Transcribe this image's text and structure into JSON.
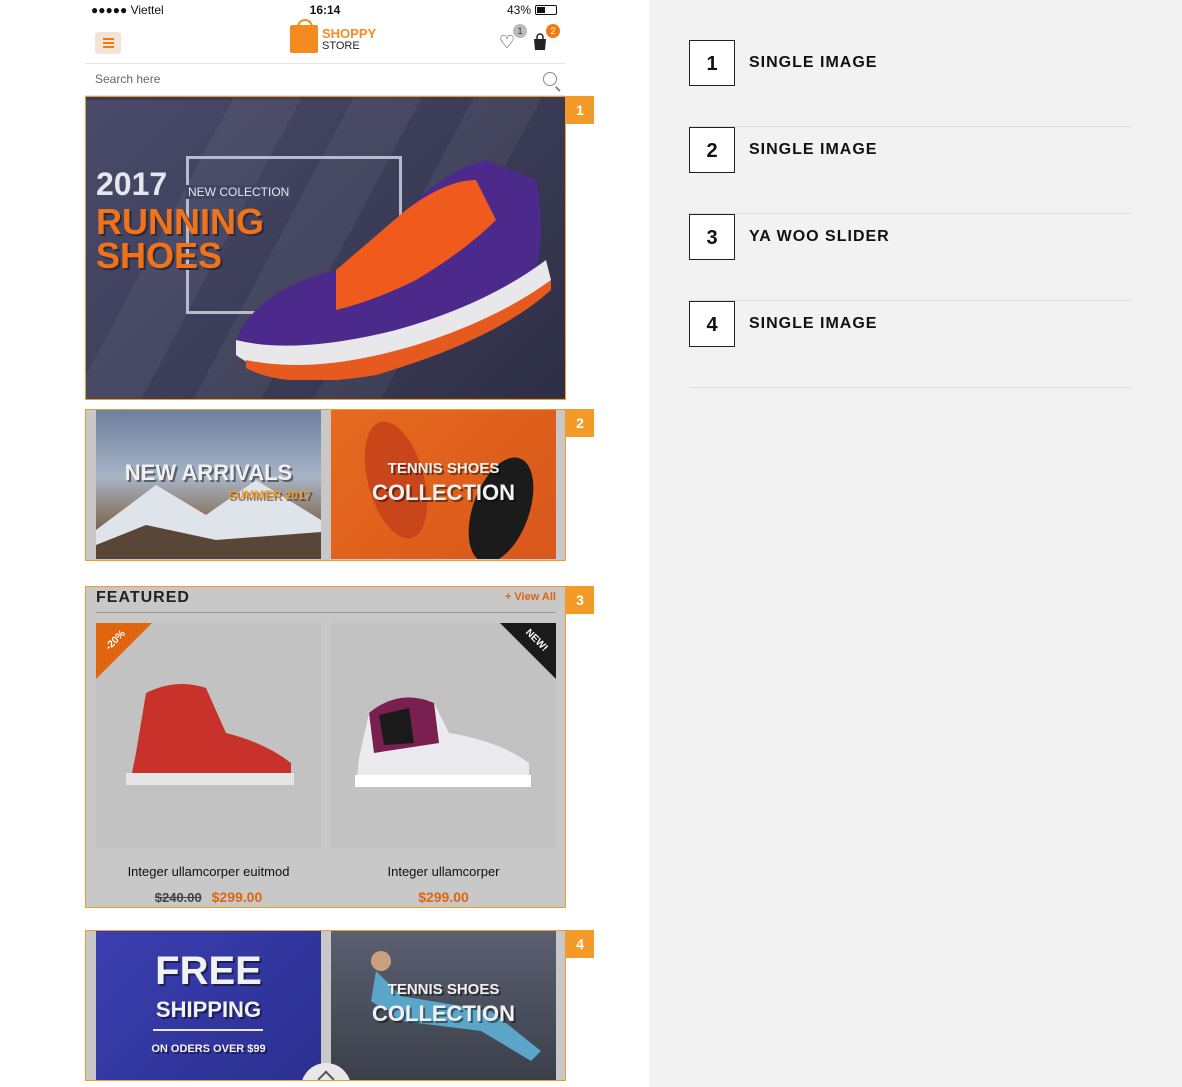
{
  "statusbar": {
    "carrier": "●●●●● Viettel",
    "time": "16:14",
    "battery": "43%"
  },
  "header": {
    "logo_line1": "SHOPPY",
    "logo_line2": "STORE",
    "wishlist_count": "1",
    "cart_count": "2",
    "accent": "#f58a1f"
  },
  "search": {
    "placeholder": "Search here"
  },
  "hero": {
    "year": "2017",
    "subtitle": "NEW COLECTION",
    "line1": "RUNNING",
    "line2": "SHOES"
  },
  "promos": [
    {
      "title": "NEW ARRIVALS",
      "subtitle": "SUMMER 2017"
    },
    {
      "title": "TENNIS SHOES",
      "subtitle": "COLLECTION"
    }
  ],
  "featured": {
    "title": "FEATURED",
    "view_all": "+ View All",
    "products": [
      {
        "name": "Integer ullamcorper euitmod",
        "old_price": "$240.00",
        "price": "$299.00",
        "tag": "-20%"
      },
      {
        "name": "Integer ullamcorper",
        "old_price": "",
        "price": "$299.00",
        "tag": "NEW!"
      }
    ]
  },
  "bottom_promos": [
    {
      "title": "FREE",
      "title2": "SHIPPING",
      "subtitle": "ON ODERS OVER $99"
    },
    {
      "title": "TENNIS SHOES",
      "subtitle": "COLLECTION"
    }
  ],
  "section_tags": [
    "1",
    "2",
    "3",
    "4"
  ],
  "legend": [
    {
      "num": "1",
      "label": "SINGLE IMAGE"
    },
    {
      "num": "2",
      "label": "SINGLE IMAGE"
    },
    {
      "num": "3",
      "label": "YA WOO SLIDER"
    },
    {
      "num": "4",
      "label": "SINGLE IMAGE"
    }
  ]
}
